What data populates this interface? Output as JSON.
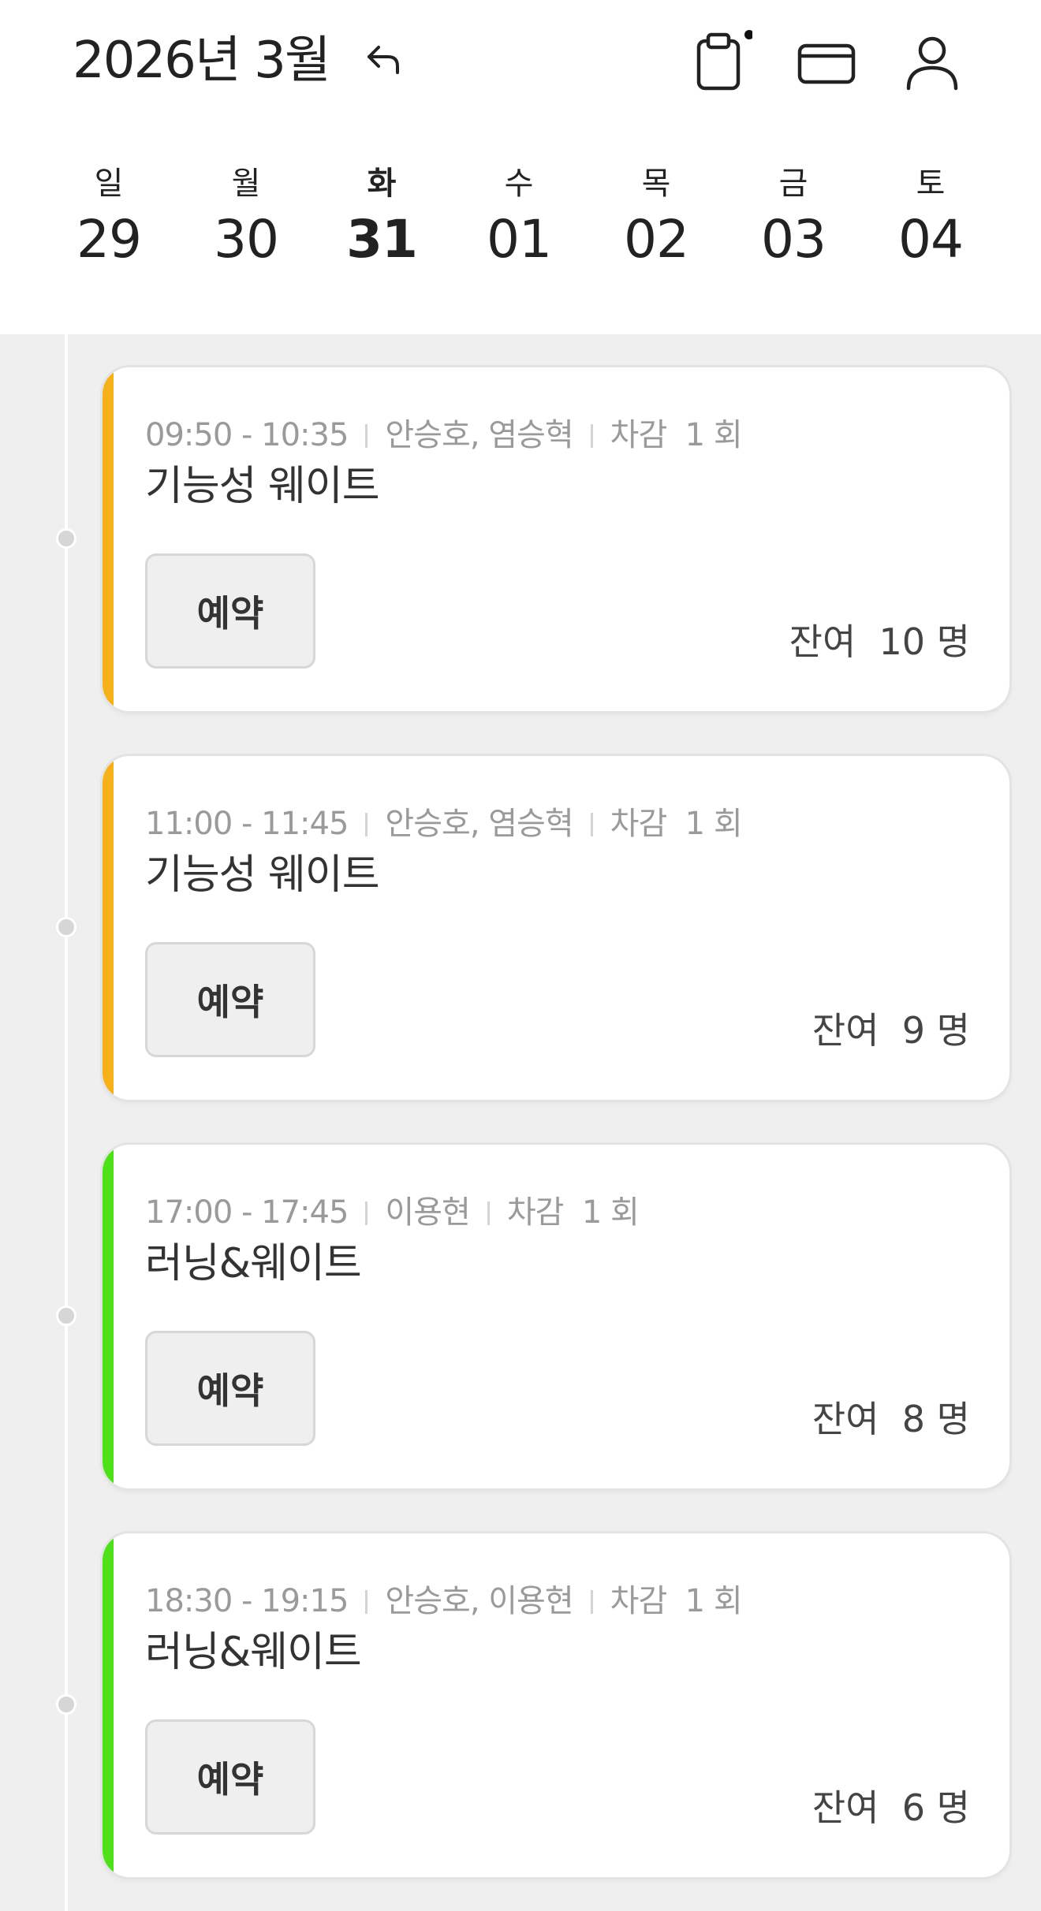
{
  "header": {
    "month_title": "2026년 3월",
    "icons": [
      "undo-arrow-icon",
      "clipboard-icon",
      "card-icon",
      "user-icon"
    ],
    "notification_dot": true
  },
  "week": [
    {
      "name": "일",
      "num": "29",
      "active": false
    },
    {
      "name": "월",
      "num": "30",
      "active": false
    },
    {
      "name": "화",
      "num": "31",
      "active": true
    },
    {
      "name": "수",
      "num": "01",
      "active": false
    },
    {
      "name": "목",
      "num": "02",
      "active": false
    },
    {
      "name": "금",
      "num": "03",
      "active": false
    },
    {
      "name": "토",
      "num": "04",
      "active": false
    }
  ],
  "classes": [
    {
      "time": "09:50 - 10:35",
      "instructors": "안승호, 염승혁",
      "deduction": "차감  1 회",
      "title": "기능성 웨이트",
      "button": "예약",
      "remaining": "잔여  10 명",
      "accent": "#f5b01a"
    },
    {
      "time": "11:00 - 11:45",
      "instructors": "안승호, 염승혁",
      "deduction": "차감  1 회",
      "title": "기능성 웨이트",
      "button": "예약",
      "remaining": "잔여  9 명",
      "accent": "#f5b01a"
    },
    {
      "time": "17:00 - 17:45",
      "instructors": "이용현",
      "deduction": "차감  1 회",
      "title": "러닝&웨이트",
      "button": "예약",
      "remaining": "잔여  8 명",
      "accent": "#4ee11a"
    },
    {
      "time": "18:30 - 19:15",
      "instructors": "안승호, 이용현",
      "deduction": "차감  1 회",
      "title": "러닝&웨이트",
      "button": "예약",
      "remaining": "잔여  6 명",
      "accent": "#4ee11a"
    }
  ],
  "colors": {
    "background": "#efefef",
    "card": "#ffffff",
    "meta_text": "#9a9a9a",
    "accent_weight": "#f5b01a",
    "accent_running": "#4ee11a"
  }
}
